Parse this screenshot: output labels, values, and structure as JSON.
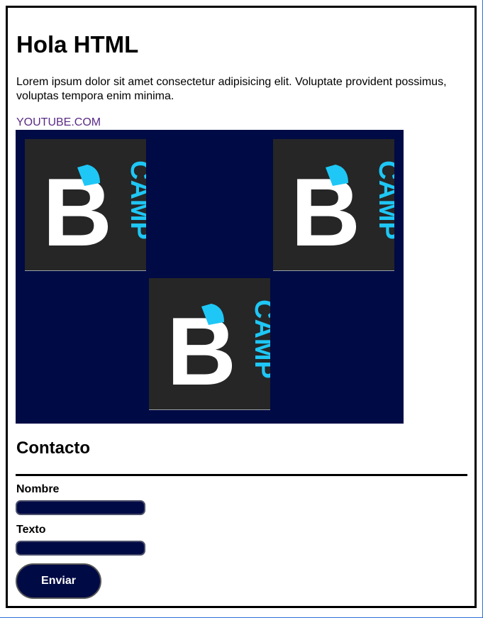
{
  "header": {
    "title": "Hola HTML",
    "intro": "Lorem ipsum dolor sit amet consectetur adipisicing elit. Voluptate provident possimus, voluptas tempora enim minima."
  },
  "link": {
    "text": "YOUTUBE.COM"
  },
  "gallery": {
    "background": "#000a45",
    "logo_text": "CAMP",
    "logo_letter": "B",
    "items": [
      "bcamp-logo",
      "bcamp-logo",
      "bcamp-logo"
    ]
  },
  "contact": {
    "title": "Contacto",
    "name_label": "Nombre",
    "name_value": "",
    "text_label": "Texto",
    "text_value": "",
    "submit_label": "Enviar"
  },
  "colors": {
    "brand_dark": "#000a45",
    "logo_accent": "#1ec7f5",
    "logo_bg": "#262626",
    "link": "#5a2a86"
  }
}
